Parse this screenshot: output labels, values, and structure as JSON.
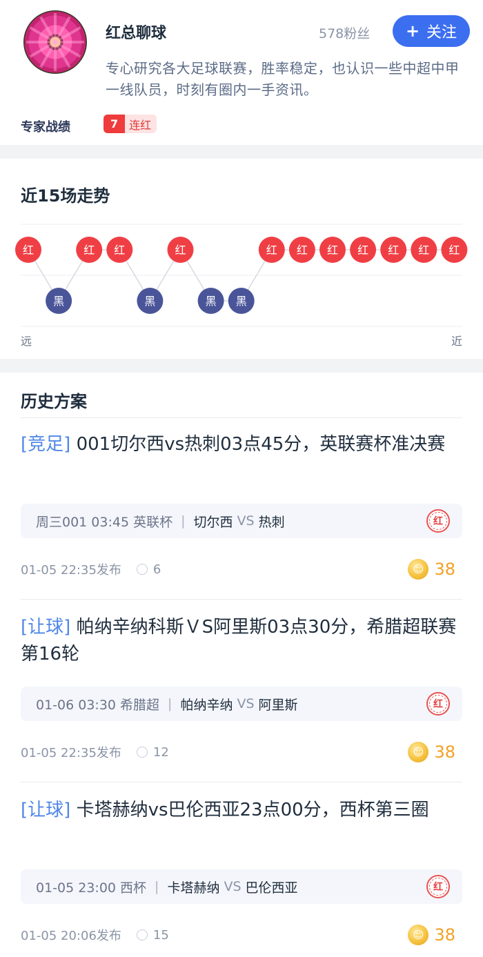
{
  "profile": {
    "avatar": "pink-gerbera-flower-avatar",
    "name": "红总聊球",
    "fans": "578粉丝",
    "follow_label": "关注",
    "follow_icon": "plus-icon",
    "intro": "专心研究各大足球联赛，胜率稳定，也认识一些中超中甲一线队员，时刻有圈内一手资讯。",
    "record_label": "专家战绩",
    "streak_count": "7",
    "streak_text": "连红"
  },
  "trend": {
    "title": "近15场走势",
    "results": [
      "红",
      "黑",
      "红",
      "红",
      "黑",
      "红",
      "黑",
      "黑",
      "红",
      "红",
      "红",
      "红",
      "红",
      "红",
      "红"
    ],
    "far_label": "远",
    "near_label": "近",
    "colors": {
      "red": "#ef3f45",
      "black": "#4a5599"
    }
  },
  "history": {
    "title": "历史方案",
    "plans": [
      {
        "tag": "[竞足]",
        "title": "001切尔西vs热刺03点45分，英联赛杯准决赛",
        "match_info": "周三001 03:45 英联杯",
        "home": "切尔西",
        "vs": "VS",
        "away": "热刺",
        "result": "红",
        "published": "01-05 22:35发布",
        "views": "6",
        "price": "38"
      },
      {
        "tag": "[让球]",
        "title": "帕纳辛纳科斯ＶS阿里斯03点30分，希腊超联赛第16轮",
        "match_info": "01-06 03:30 希腊超",
        "home": "帕纳辛纳",
        "vs": "VS",
        "away": "阿里斯",
        "result": "红",
        "published": "01-05 22:35发布",
        "views": "12",
        "price": "38"
      },
      {
        "tag": "[让球]",
        "title": "卡塔赫纳vs巴伦西亚23点00分，西杯第三圈",
        "match_info": "01-05 23:00 西杯",
        "home": "卡塔赫纳",
        "vs": "VS",
        "away": "巴伦西亚",
        "result": "红",
        "published": "01-05 20:06发布",
        "views": "15",
        "price": "38"
      }
    ]
  }
}
